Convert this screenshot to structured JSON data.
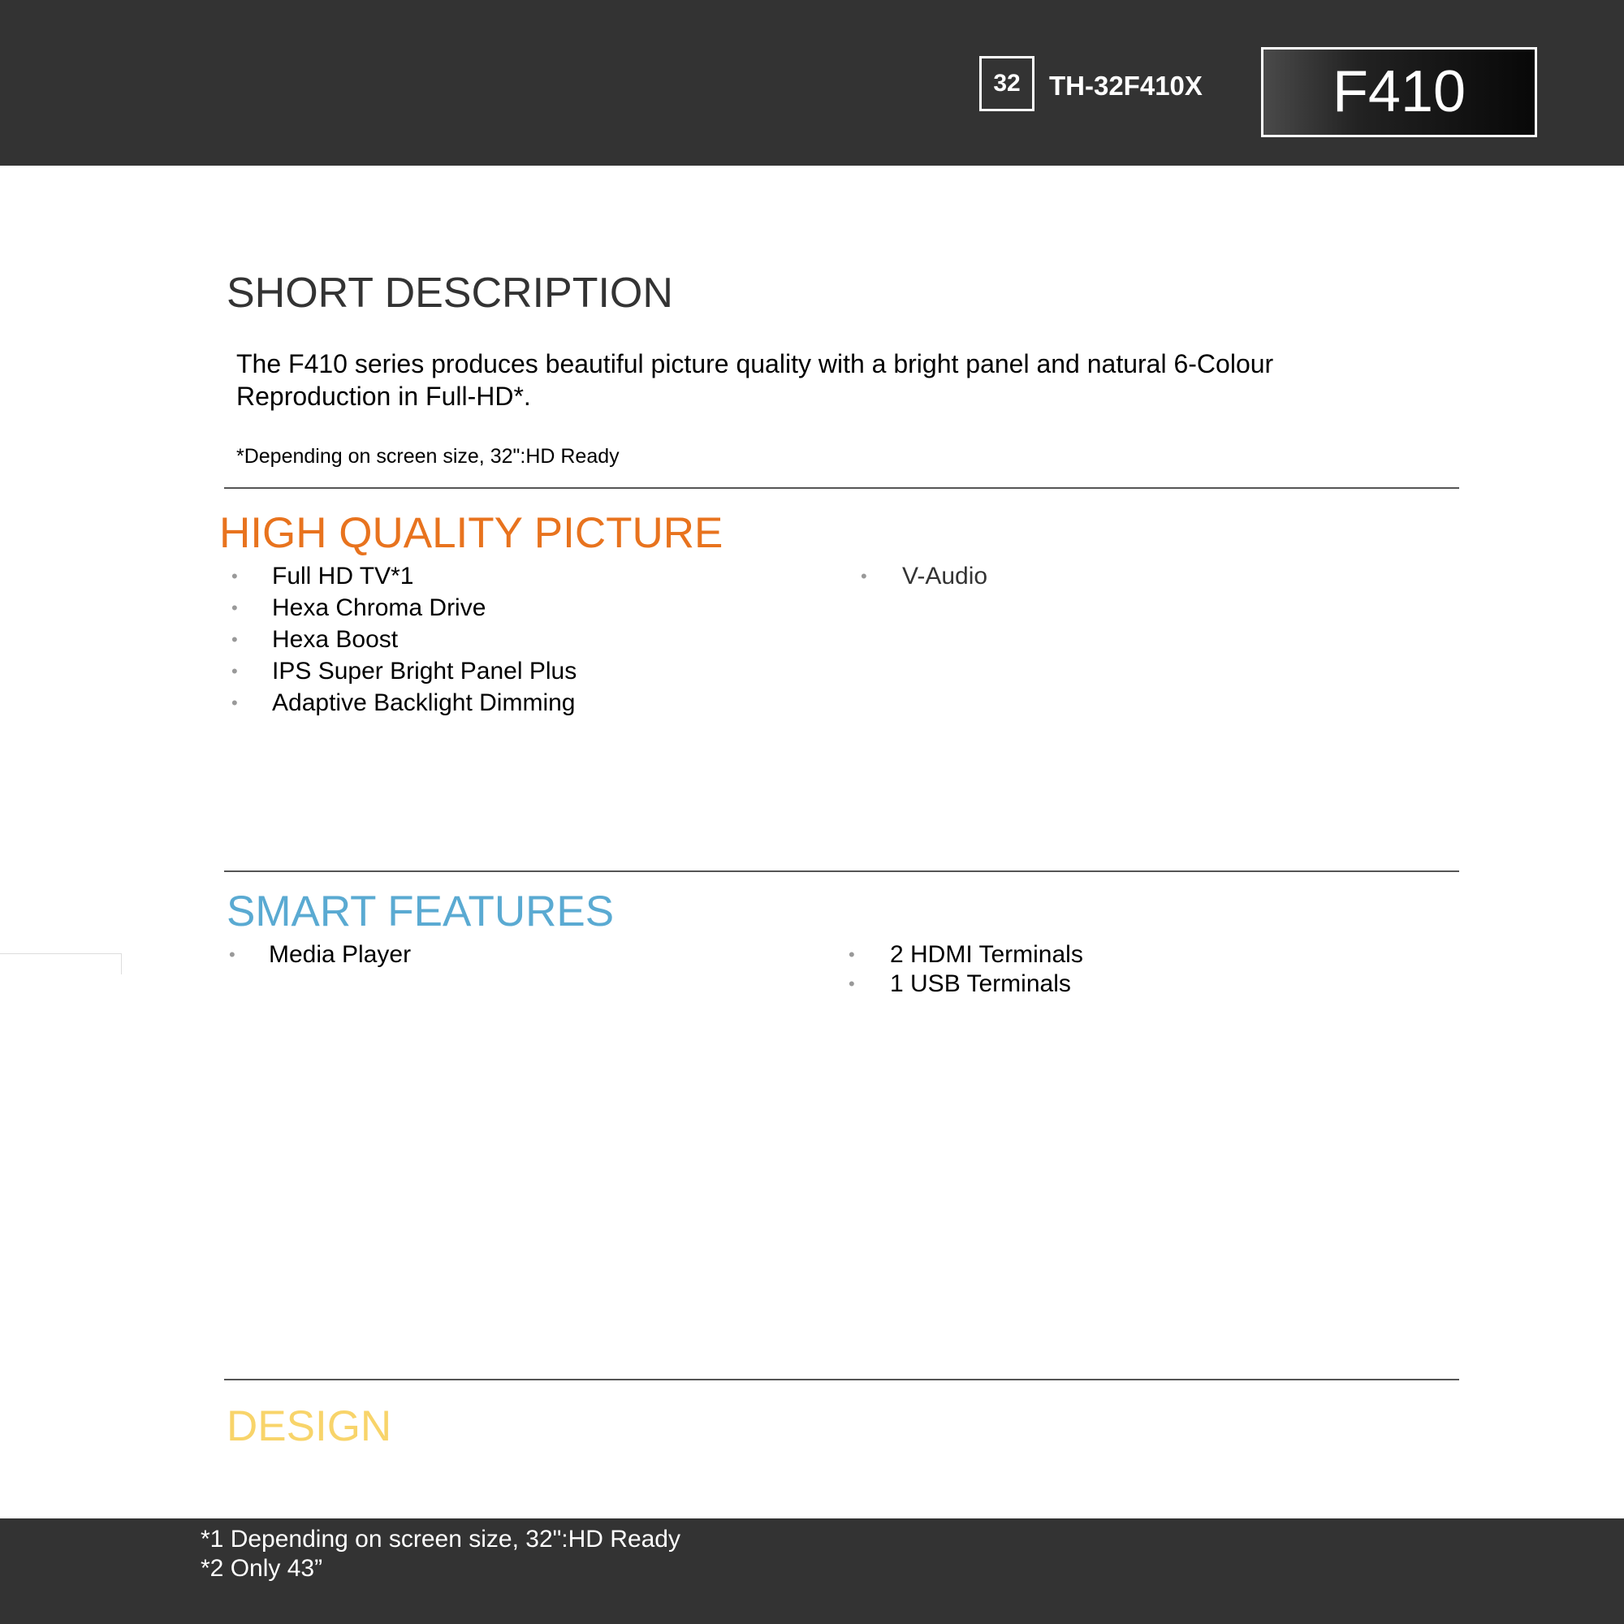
{
  "header": {
    "size_badge": "32",
    "model_code": "TH-32F410X",
    "series_label": "F410"
  },
  "short_description": {
    "heading": "SHORT DESCRIPTION",
    "text": "The F410 series produces beautiful picture quality with a bright panel and natural 6-Colour Reproduction in Full-HD*.",
    "note": "*Depending on screen size, 32\":HD Ready"
  },
  "sections": {
    "picture": {
      "heading": "HIGH QUALITY PICTURE",
      "color": "#e8731e",
      "left_items": [
        "Full HD TV*1",
        "Hexa Chroma Drive",
        "Hexa Boost",
        "IPS Super Bright Panel Plus",
        "Adaptive Backlight Dimming"
      ],
      "right_items": [
        "V-Audio"
      ]
    },
    "smart": {
      "heading": "SMART FEATURES",
      "color": "#5aaad2",
      "left_items": [
        "Media Player"
      ],
      "right_items": [
        "2 HDMI Terminals",
        "1 USB Terminals"
      ]
    },
    "design": {
      "heading": "DESIGN",
      "color": "#f8d46a"
    }
  },
  "footer": {
    "notes": [
      "*1 Depending on screen size, 32\":HD Ready",
      "*2 Only 43”"
    ]
  },
  "icons": {
    "bullet": "bullet-dot"
  }
}
